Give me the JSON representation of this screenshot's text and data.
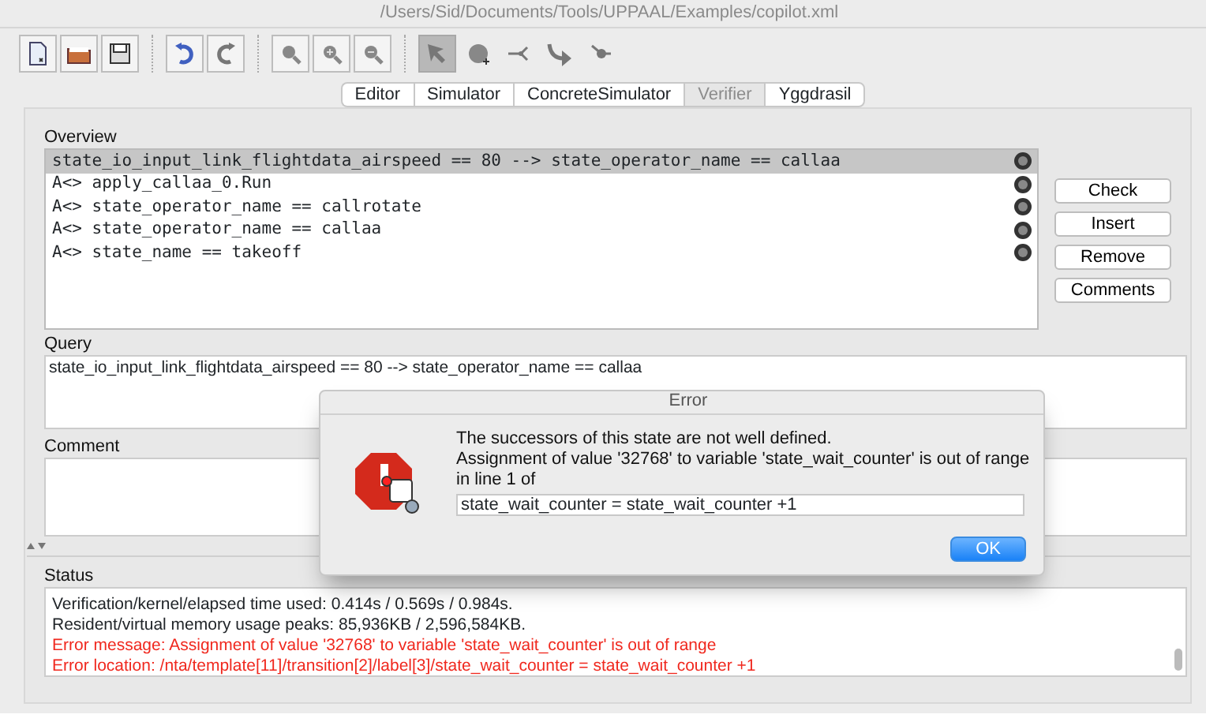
{
  "window": {
    "title": "/Users/Sid/Documents/Tools/UPPAAL/Examples/copilot.xml"
  },
  "toolbar": [
    {
      "tools": [
        {
          "kind": "new",
          "selected": false
        },
        {
          "kind": "open",
          "selected": false
        },
        {
          "kind": "save",
          "selected": false
        }
      ]
    },
    {
      "tools": [
        {
          "kind": "undo",
          "selected": false
        },
        {
          "kind": "redo",
          "selected": false
        }
      ]
    },
    {
      "tools": [
        {
          "kind": "zoom",
          "selected": false
        },
        {
          "kind": "zoom-in",
          "selected": false
        },
        {
          "kind": "zoom-out",
          "selected": false
        }
      ]
    },
    {
      "tools": [
        {
          "kind": "select",
          "selected": true
        },
        {
          "kind": "location",
          "selected": false
        },
        {
          "kind": "branch",
          "selected": false
        },
        {
          "kind": "edge",
          "selected": false
        },
        {
          "kind": "nail",
          "selected": false
        }
      ]
    }
  ],
  "tabs": [
    {
      "label": "Editor",
      "selected": false
    },
    {
      "label": "Simulator",
      "selected": false
    },
    {
      "label": "ConcreteSimulator",
      "selected": false
    },
    {
      "label": "Verifier",
      "selected": true
    },
    {
      "label": "Yggdrasil",
      "selected": false
    }
  ],
  "overview": {
    "label": "Overview",
    "rows": [
      {
        "text": "state_io_input_link_flightdata_airspeed == 80 --> state_operator_name == callaa",
        "selected": true
      },
      {
        "text": "A<> apply_callaa_0.Run",
        "selected": false
      },
      {
        "text": "A<> state_operator_name == callrotate",
        "selected": false
      },
      {
        "text": "A<> state_operator_name == callaa",
        "selected": false
      },
      {
        "text": "A<> state_name == takeoff",
        "selected": false
      }
    ]
  },
  "buttons": [
    "Check",
    "Insert",
    "Remove",
    "Comments"
  ],
  "query": {
    "label": "Query",
    "value": "state_io_input_link_flightdata_airspeed == 80 --> state_operator_name == callaa"
  },
  "comment": {
    "label": "Comment"
  },
  "status": {
    "label": "Status",
    "lines": [
      {
        "text": "Verification/kernel/elapsed time used: 0.414s / 0.569s / 0.984s.",
        "kind": "info"
      },
      {
        "text": "Resident/virtual memory usage peaks: 85,936KB / 2,596,584KB.",
        "kind": "info"
      },
      {
        "text": "Error message: Assignment of value '32768' to variable 'state_wait_counter' is out of range",
        "kind": "error"
      },
      {
        "text": "Error location: /nta/template[11]/transition[2]/label[3]/state_wait_counter = state_wait_counter +1",
        "kind": "error"
      }
    ]
  },
  "dialog": {
    "title": "Error",
    "message": [
      "The successors of this state are not well defined.",
      "Assignment of value '32768' to variable 'state_wait_counter' is out of range",
      "in line 1 of"
    ],
    "value": "state_wait_counter = state_wait_counter +1",
    "button": "OK"
  }
}
